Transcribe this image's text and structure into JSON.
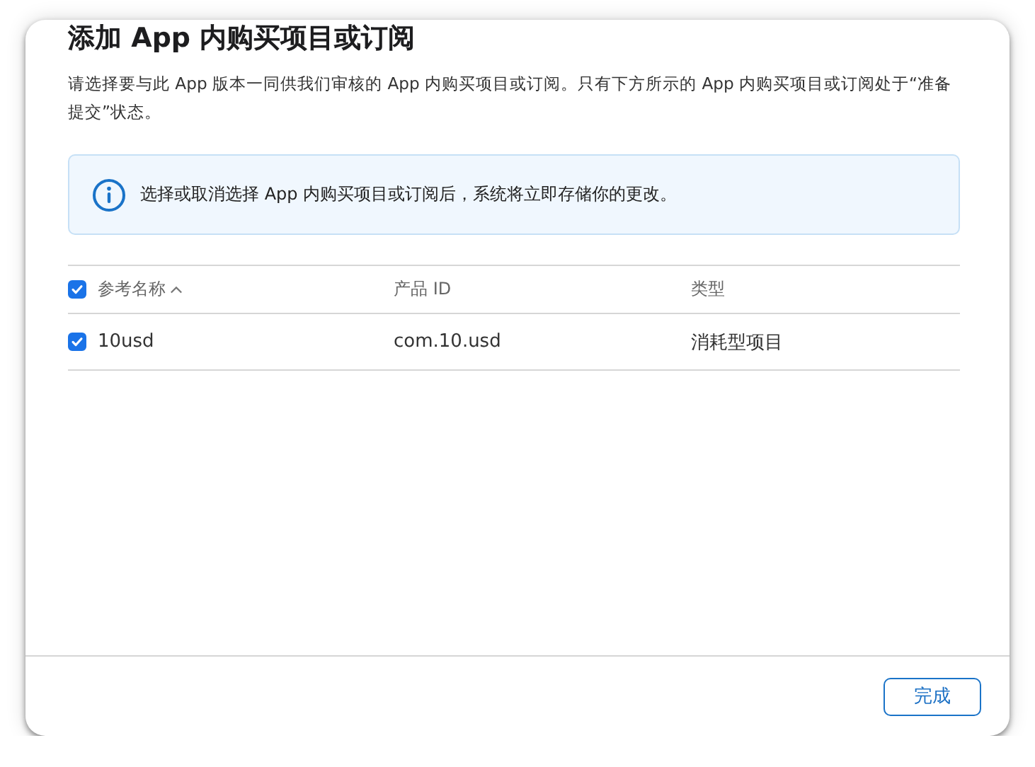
{
  "dialog": {
    "title": "添加 App 内购买项目或订阅",
    "description": "请选择要与此 App 版本一同供我们审核的 App 内购买项目或订阅。只有下方所示的 App 内购买项目或订阅处于“准备提交”状态。"
  },
  "notice": {
    "text": "选择或取消选择 App 内购买项目或订阅后，系统将立即存储你的更改。"
  },
  "table": {
    "select_all": {
      "checked": true
    },
    "columns": [
      {
        "label": "参考名称",
        "sorted": true
      },
      {
        "label": "产品 ID",
        "sorted": false
      },
      {
        "label": "类型",
        "sorted": false
      }
    ],
    "rows": [
      {
        "checked": true,
        "cells": [
          "10usd",
          "com.10.usd",
          "消耗型项目"
        ]
      }
    ]
  },
  "buttons": [
    {
      "label": "完成"
    }
  ]
}
